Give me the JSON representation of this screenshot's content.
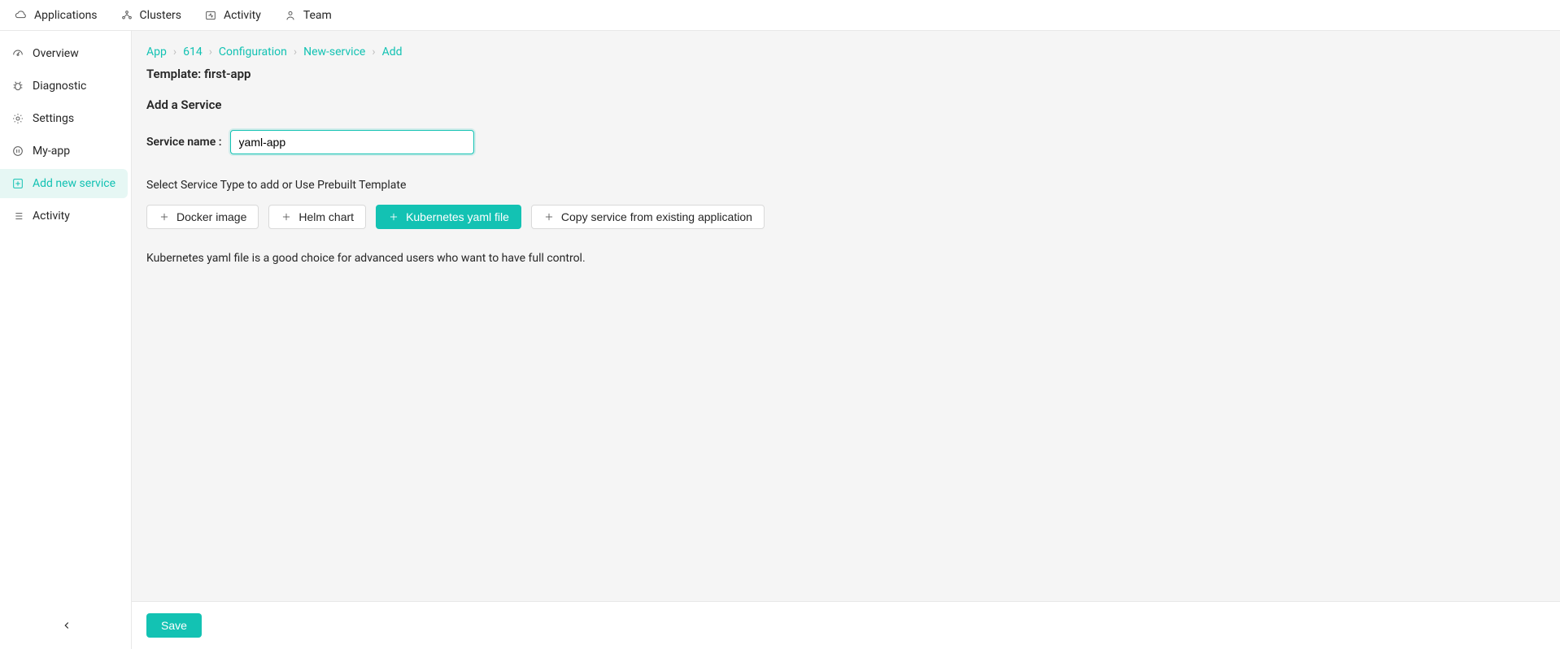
{
  "topnav": {
    "applications": "Applications",
    "clusters": "Clusters",
    "activity": "Activity",
    "team": "Team"
  },
  "sidebar": {
    "overview": "Overview",
    "diagnostic": "Diagnostic",
    "settings": "Settings",
    "myapp": "My-app",
    "addnew": "Add new service",
    "activity": "Activity"
  },
  "breadcrumb": {
    "app": "App",
    "id": "614",
    "config": "Configuration",
    "newservice": "New-service",
    "add": "Add"
  },
  "template_label": "Template: ",
  "template_name": "first-app",
  "section_title": "Add a Service",
  "service_name_label": "Service name :",
  "service_name_value": "yaml-app",
  "select_type_hint": "Select Service Type to add or Use Prebuilt Template",
  "types": {
    "docker": "Docker image",
    "helm": "Helm chart",
    "k8s": "Kubernetes yaml file",
    "copy": "Copy service from existing application"
  },
  "description": "Kubernetes yaml file is a good choice for advanced users who want to have full control.",
  "save": "Save"
}
